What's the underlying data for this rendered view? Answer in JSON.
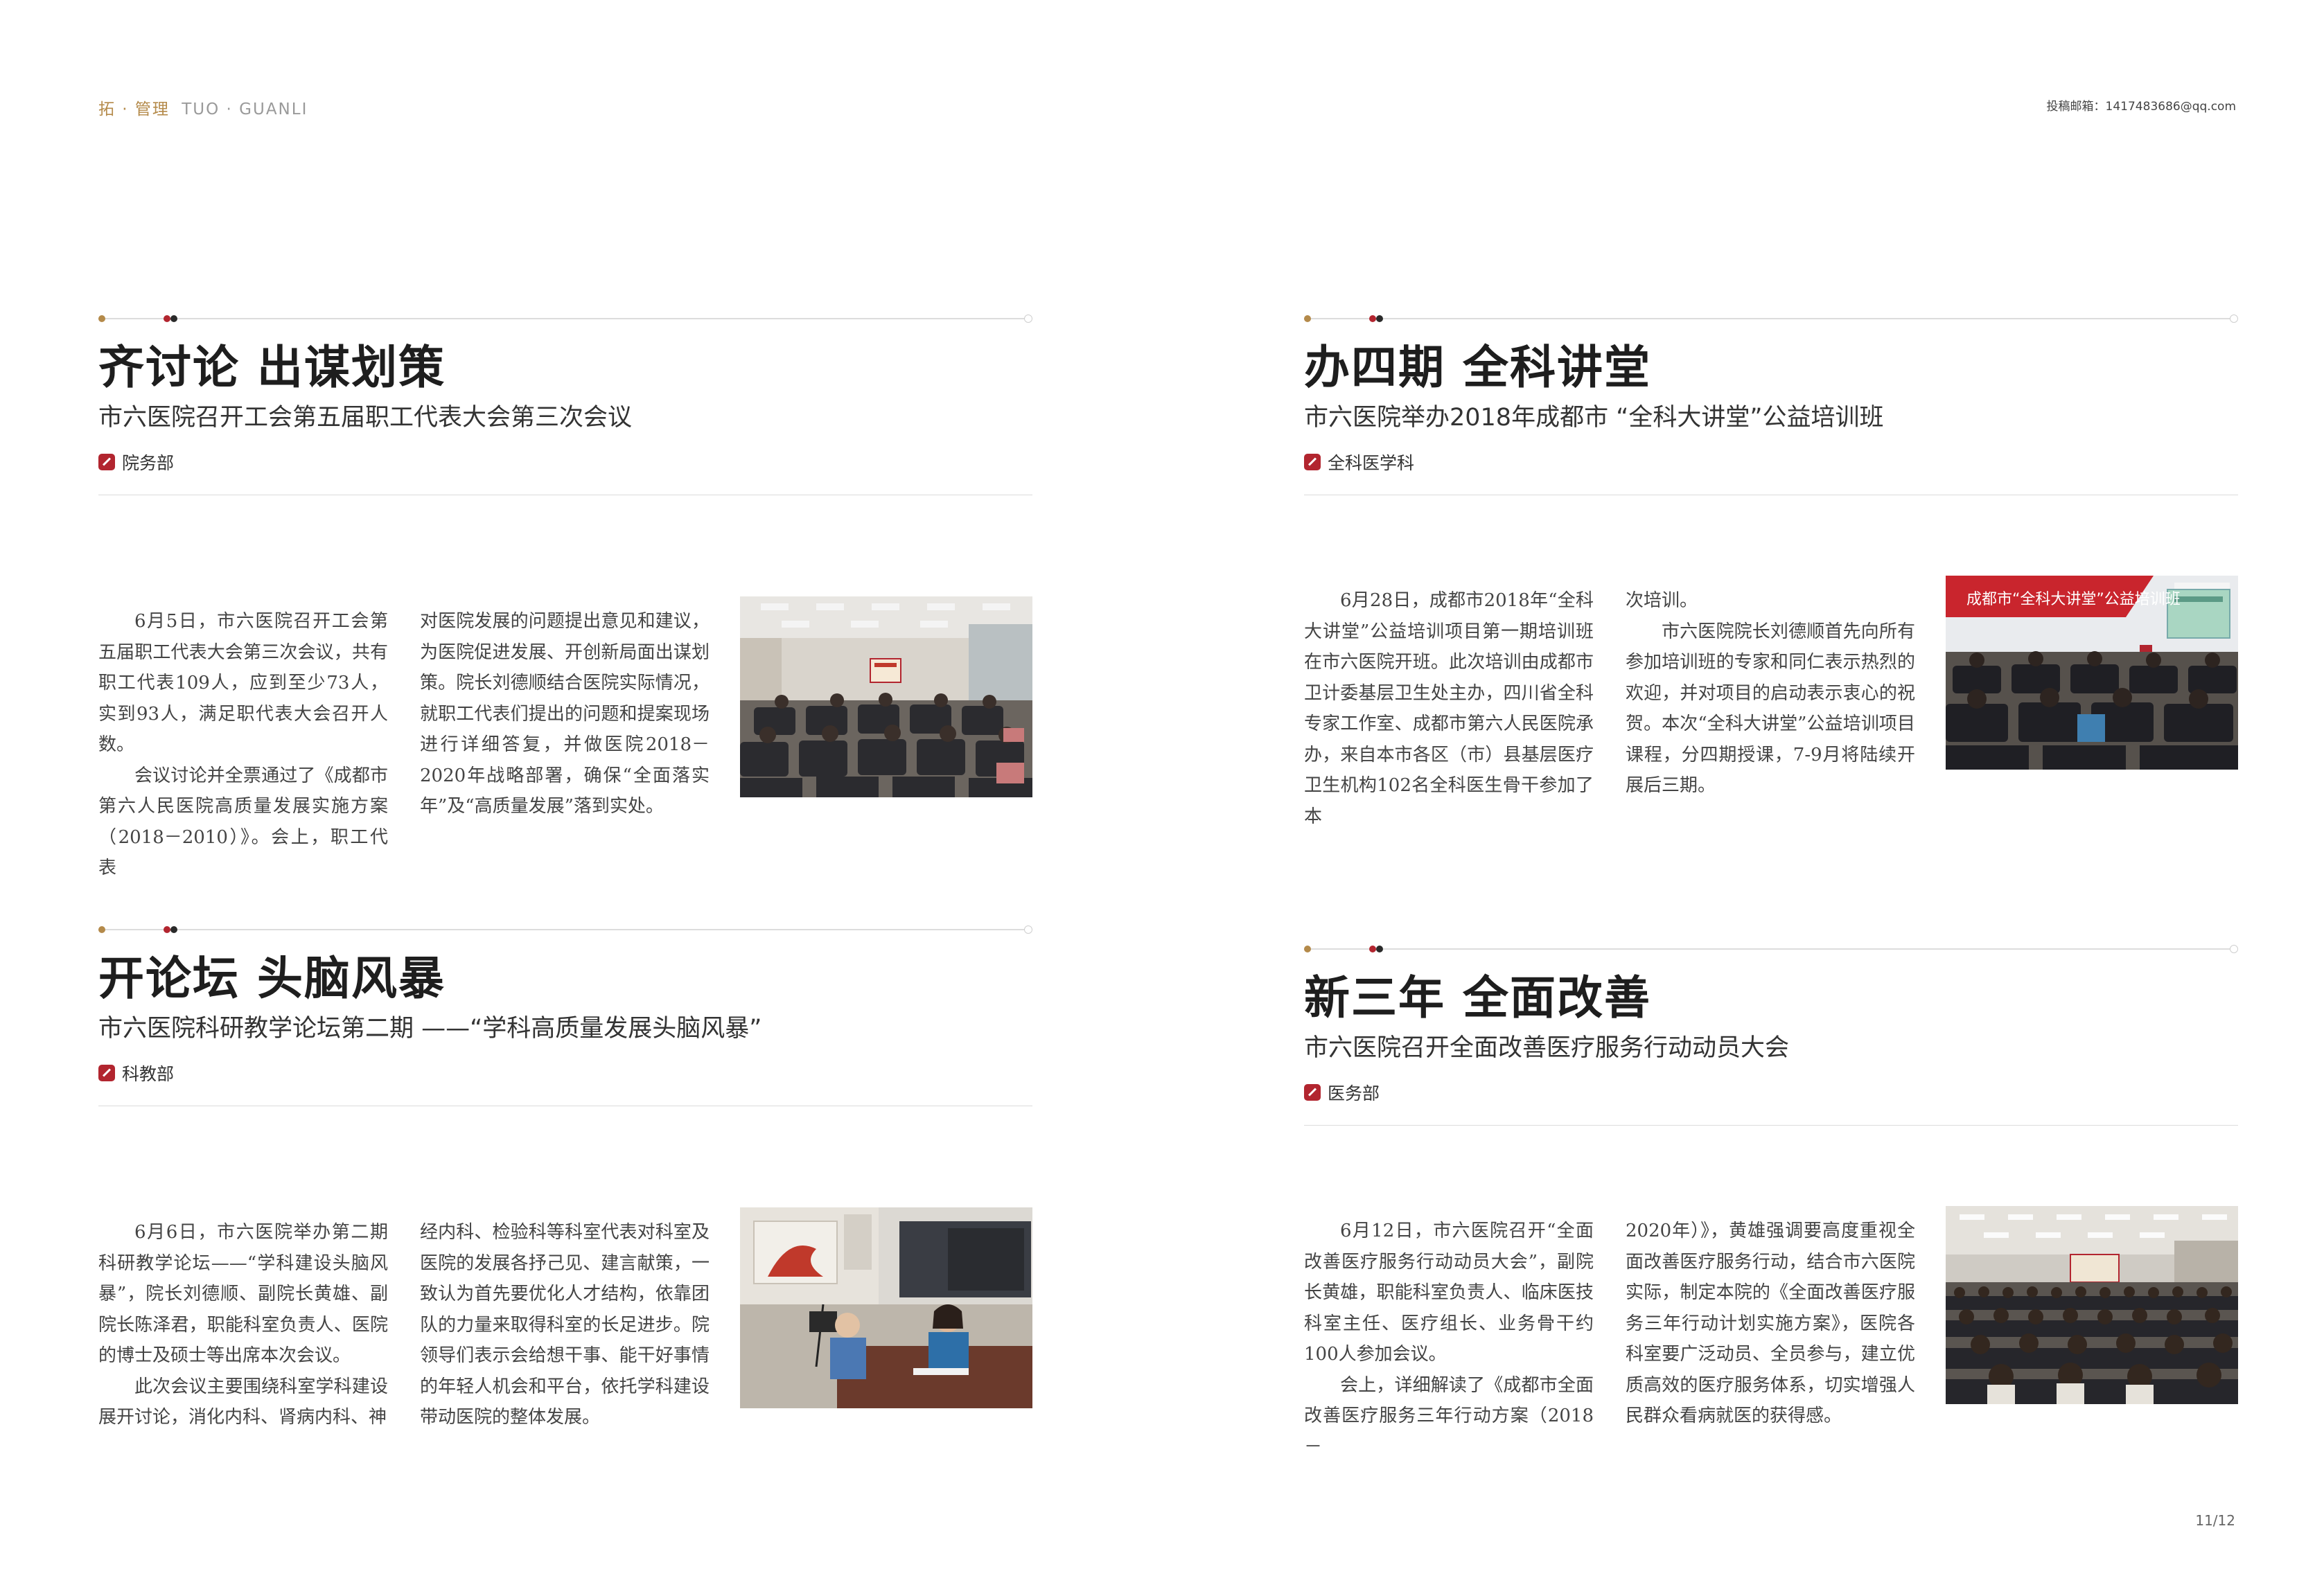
{
  "header": {
    "section_cn": "拓 · 管理",
    "section_en": "TUO · GUANLI",
    "contact": "投稿邮箱：1417483686@qq.com"
  },
  "page_number": "11/12",
  "colors": {
    "accent_gold": "#b48a4a",
    "accent_red": "#b2252f"
  },
  "articles": [
    {
      "title": "齐讨论  出谋划策",
      "subtitle": "市六医院召开工会第五届职工代表大会第三次会议",
      "dept": "院务部",
      "col1": [
        "6月5日，市六医院召开工会第五届职工代表大会第三次会议，共有职工代表109人，应到至少73人，实到93人，满足职代表大会召开人数。",
        "会议讨论并全票通过了《成都市第六人民医院高质量发展实施方案（2018－2010）》。会上，职工代表"
      ],
      "col2": [
        "对医院发展的问题提出意见和建议，为医院促进发展、开创新局面出谋划策。院长刘德顺结合医院实际情况，就职工代表们提出的问题和提案现场进行详细答复，并做医院2018－2020年战略部署，确保“全面落实年”及“高质量发展”落到实处。"
      ],
      "photo_icon": "conference-room-photo"
    },
    {
      "title": "办四期  全科讲堂",
      "subtitle": "市六医院举办2018年成都市 “全科大讲堂”公益培训班",
      "dept": "全科医学科",
      "col1": [
        "6月28日，成都市2018年“全科大讲堂”公益培训项目第一期培训班在市六医院开班。此次培训由成都市卫计委基层卫生处主办，四川省全科专家工作室、成都市第六人民医院承办，来自本市各区（市）县基层医疗卫生机构102名全科医生骨干参加了本"
      ],
      "col2": [
        "次培训。",
        "市六医院院长刘德顺首先向所有参加培训班的专家和同仁表示热烈的欢迎，并对项目的启动表示衷心的祝贺。本次“全科大讲堂”公益培训项目课程，分四期授课，7-9月将陆续开展后三期。"
      ],
      "photo_icon": "lecture-hall-photo",
      "photo_banner": "成都市“全科大讲堂”公益培训班"
    },
    {
      "title": "开论坛  头脑风暴",
      "subtitle": "市六医院科研教学论坛第二期 ——“学科高质量发展头脑风暴”",
      "dept": "科教部",
      "col1": [
        "6月6日，市六医院举办第二期科研教学论坛——“学科建设头脑风暴”，院长刘德顺、副院长黄雄、副院长陈泽君，职能科室负责人、医院的博士及硕士等出席本次会议。",
        "此次会议主要围绕科室学科建设展开讨论，消化内科、肾病内科、神"
      ],
      "col2": [
        "经内科、检验科等科室代表对科室及医院的发展各抒己见、建言献策，一致认为首先要优化人才结构，依靠团队的力量来取得科室的长足进步。院领导们表示会给想干事、能干好事情的年轻人机会和平台，依托学科建设带动医院的整体发展。"
      ],
      "photo_icon": "forum-speakers-photo"
    },
    {
      "title": "新三年  全面改善",
      "subtitle": "市六医院召开全面改善医疗服务行动动员大会",
      "dept": "医务部",
      "col1": [
        "6月12日，市六医院召开“全面改善医疗服务行动动员大会”，副院长黄雄，职能科室负责人、临床医技科室主任、医疗组长、业务骨干约100人参加会议。",
        "会上，详细解读了《成都市全面改善医疗服务三年行动方案（2018－"
      ],
      "col2": [
        "2020年）》，黄雄强调要高度重视全面改善医疗服务行动，结合市六医院实际，制定本院的《全面改善医疗服务三年行动计划实施方案》，医院各科室要广泛动员、全员参与，建立优质高效的医疗服务体系，切实增强人民群众看病就医的获得感。"
      ],
      "photo_icon": "mobilization-meeting-photo"
    }
  ]
}
